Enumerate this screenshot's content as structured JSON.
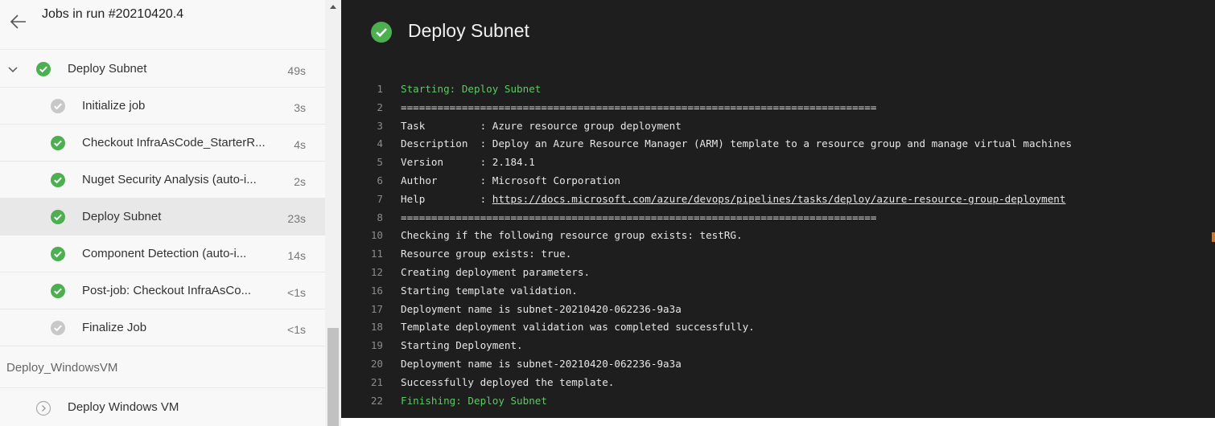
{
  "header": {
    "title": "Jobs in run #20210420.4"
  },
  "stage": {
    "name": "Deploy Subnet",
    "duration": "49s"
  },
  "steps": [
    {
      "label": "Initialize job",
      "duration": "3s",
      "status": "skipped"
    },
    {
      "label": "Checkout InfraAsCode_StarterR...",
      "duration": "4s",
      "status": "success"
    },
    {
      "label": "Nuget Security Analysis (auto-i...",
      "duration": "2s",
      "status": "success"
    },
    {
      "label": "Deploy Subnet",
      "duration": "23s",
      "status": "success",
      "selected": true
    },
    {
      "label": "Component Detection (auto-i...",
      "duration": "14s",
      "status": "success"
    },
    {
      "label": "Post-job: Checkout InfraAsCo...",
      "duration": "<1s",
      "status": "success"
    },
    {
      "label": "Finalize Job",
      "duration": "<1s",
      "status": "skipped"
    }
  ],
  "next_stage": {
    "section": "Deploy_WindowsVM",
    "job": "Deploy Windows VM"
  },
  "log": {
    "title": "Deploy Subnet",
    "lines": [
      {
        "n": "1",
        "text": "Starting: Deploy Subnet",
        "style": "green"
      },
      {
        "n": "2",
        "text": "=============================================================================="
      },
      {
        "n": "3",
        "text": "Task         : Azure resource group deployment"
      },
      {
        "n": "4",
        "text": "Description  : Deploy an Azure Resource Manager (ARM) template to a resource group and manage virtual machines"
      },
      {
        "n": "5",
        "text": "Version      : 2.184.1"
      },
      {
        "n": "6",
        "text": "Author       : Microsoft Corporation"
      },
      {
        "n": "7",
        "text": "Help         : ",
        "link": "https://docs.microsoft.com/azure/devops/pipelines/tasks/deploy/azure-resource-group-deployment"
      },
      {
        "n": "8",
        "text": "=============================================================================="
      },
      {
        "n": "10",
        "text": "Checking if the following resource group exists: testRG."
      },
      {
        "n": "11",
        "text": "Resource group exists: true."
      },
      {
        "n": "12",
        "text": "Creating deployment parameters."
      },
      {
        "n": "16",
        "text": "Starting template validation."
      },
      {
        "n": "17",
        "text": "Deployment name is subnet-20210420-062236-9a3a"
      },
      {
        "n": "18",
        "text": "Template deployment validation was completed successfully."
      },
      {
        "n": "19",
        "text": "Starting Deployment."
      },
      {
        "n": "20",
        "text": "Deployment name is subnet-20210420-062236-9a3a"
      },
      {
        "n": "21",
        "text": "Successfully deployed the template."
      },
      {
        "n": "22",
        "text": "Finishing: Deploy Subnet",
        "style": "green"
      }
    ]
  },
  "colors": {
    "success": "#4caf50",
    "skipped": "#c8c8c8",
    "log_bg": "#1e1e1e",
    "log_green": "#5ec866"
  }
}
